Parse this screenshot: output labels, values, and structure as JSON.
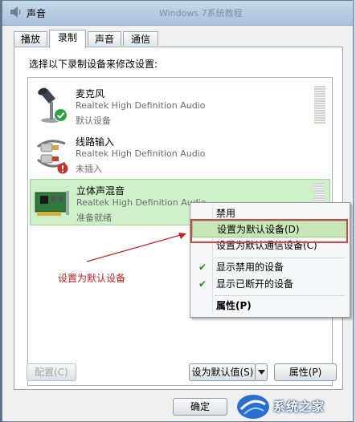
{
  "window": {
    "title": "声音",
    "background_title": "Windows 7系统教程"
  },
  "tabs": [
    {
      "label": "播放"
    },
    {
      "label": "录制"
    },
    {
      "label": "声音"
    },
    {
      "label": "通信"
    }
  ],
  "active_tab": 1,
  "instruction": "选择以下录制设备来修改设置:",
  "devices": [
    {
      "name": "麦克风",
      "driver": "Realtek High Definition Audio",
      "status": "默认设备"
    },
    {
      "name": "线路输入",
      "driver": "Realtek High Definition Audio",
      "status": "未插入"
    },
    {
      "name": "立体声混音",
      "driver": "Realtek High Definition Audio",
      "status": "准备就绪"
    }
  ],
  "context_menu": {
    "items": [
      {
        "label": "禁用"
      },
      {
        "label": "设置为默认设备(D)"
      },
      {
        "label": "设置为默认通信设备(C)"
      },
      {
        "label": "显示禁用的设备"
      },
      {
        "label": "显示已断开的设备"
      },
      {
        "label": "属性(P)"
      }
    ]
  },
  "buttons": {
    "configure": "配置(C)",
    "set_default": "设为默认值(S)",
    "properties": "属性(P)",
    "ok": "确定"
  },
  "annotation": "设置为默认设备",
  "watermark": "系统之家",
  "colors": {
    "selection": "#cdf0c8",
    "menu_highlight": "#c7e7b8",
    "annotation_red": "#c02020",
    "default_badge_green": "#2ea043"
  }
}
